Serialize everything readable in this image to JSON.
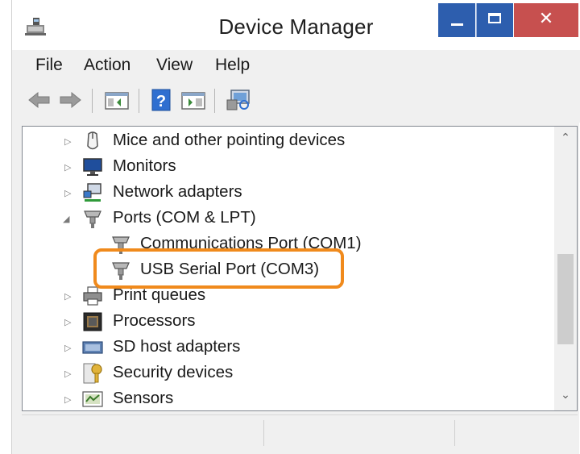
{
  "window": {
    "title": "Device Manager",
    "close_glyph": "✕",
    "minimize_icon": "minimize-icon",
    "maximize_icon": "maximize-icon",
    "close_icon": "close-icon",
    "app_icon": "device-manager-icon"
  },
  "menu": {
    "items": [
      {
        "label": "File"
      },
      {
        "label": "Action"
      },
      {
        "label": "View"
      },
      {
        "label": "Help"
      }
    ]
  },
  "toolbar": {
    "icons": [
      "back-arrow-icon",
      "forward-arrow-icon",
      "show-hide-console-tree-icon",
      "help-icon",
      "properties-icon",
      "scan-hardware-changes-icon"
    ]
  },
  "tree": {
    "items": [
      {
        "label": "Mice and other pointing devices",
        "expanded": false,
        "icon": "mouse-icon"
      },
      {
        "label": "Monitors",
        "expanded": false,
        "icon": "monitor-icon"
      },
      {
        "label": "Network adapters",
        "expanded": false,
        "icon": "network-adapter-icon"
      },
      {
        "label": "Ports (COM & LPT)",
        "expanded": true,
        "icon": "port-icon"
      },
      {
        "label": "Communications Port (COM1)",
        "child": true,
        "icon": "port-icon"
      },
      {
        "label": "USB Serial Port (COM3)",
        "child": true,
        "icon": "port-icon",
        "highlighted": true
      },
      {
        "label": "Print queues",
        "expanded": false,
        "icon": "printer-icon"
      },
      {
        "label": "Processors",
        "expanded": false,
        "icon": "processor-icon"
      },
      {
        "label": "SD host adapters",
        "expanded": false,
        "icon": "sd-adapter-icon"
      },
      {
        "label": "Security devices",
        "expanded": false,
        "icon": "key-icon"
      },
      {
        "label": "Sensors",
        "expanded": false,
        "icon": "sensor-icon"
      }
    ],
    "collapsed_glyph": "▷",
    "expanded_glyph": "◢",
    "scroll_up_glyph": "⌃",
    "scroll_down_glyph": "⌄"
  },
  "colors": {
    "highlight_border": "#f08a1c",
    "titlebar_button": "#2d5eae",
    "close_button": "#c7504f"
  }
}
